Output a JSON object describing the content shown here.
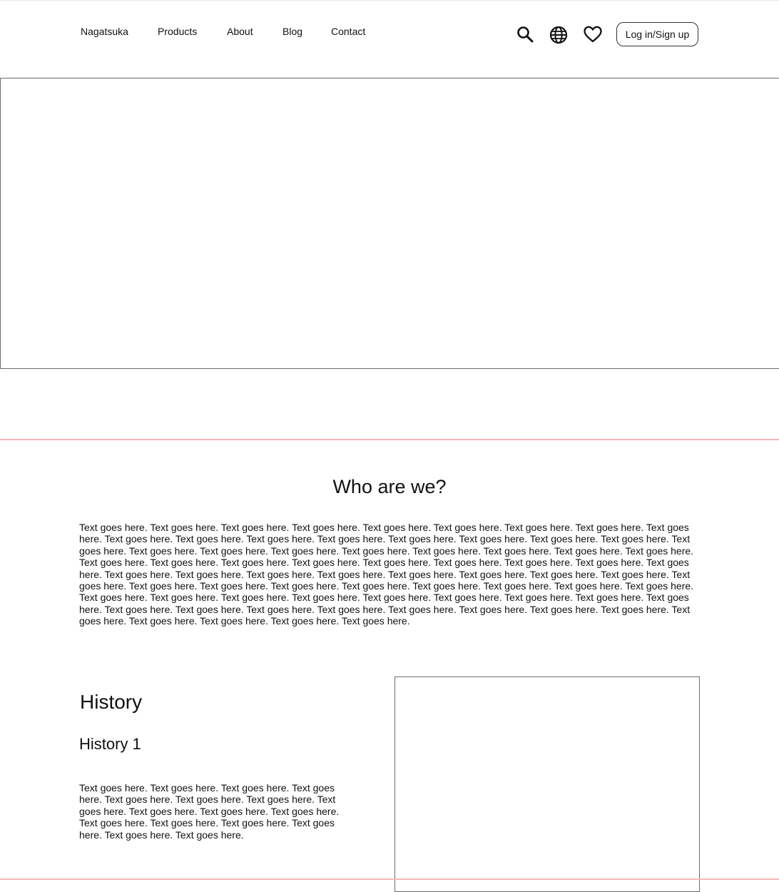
{
  "nav": {
    "links": [
      {
        "label": "Nagatsuka"
      },
      {
        "label": "Products"
      },
      {
        "label": "About"
      },
      {
        "label": "Blog"
      },
      {
        "label": "Contact"
      }
    ],
    "icons": [
      "search-icon",
      "globe-icon",
      "heart-icon"
    ],
    "login_label": "Log in/Sign up"
  },
  "about": {
    "title": "Who are we?",
    "body": "Text goes here. Text goes here. Text goes here. Text goes here. Text goes here. Text goes here. Text goes here. Text goes here. Text goes here. Text goes here. Text goes here. Text goes here. Text goes here. Text goes here. Text goes here. Text goes here. Text goes here. Text goes here. Text goes here. Text goes here. Text goes here. Text goes here. Text goes here. Text goes here. Text goes here. Text goes here. Text goes here. Text goes here. Text goes here. Text goes here. Text goes here. Text goes here. Text goes here. Text goes here. Text goes here. Text goes here. Text goes here. Text goes here. Text goes here. Text goes here. Text goes here. Text goes here. Text goes here. Text goes here. Text goes here. Text goes here. Text goes here. Text goes here. Text goes here. Text goes here. Text goes here. Text goes here. Text goes here. Text goes here. Text goes here. Text goes here. Text goes here. Text goes here. Text goes here. Text goes here. Text goes here. Text goes here. Text goes here. Text goes here. Text goes here. Text goes here. Text goes here. Text goes here. Text goes here. Text goes here. Text goes here. Text goes here. Text goes here. Text goes here."
  },
  "history": {
    "title": "History",
    "subtitle": "History 1",
    "body": "Text goes here. Text goes here. Text goes here. Text goes here. Text goes here. Text goes here. Text goes here. Text goes here. Text goes here. Text goes here. Text goes here. Text goes here. Text goes here. Text goes here. Text goes here. Text goes here. Text goes here."
  },
  "colors": {
    "divider": "#f2b8b5",
    "border": "#6b6b6b",
    "text": "#111111"
  }
}
